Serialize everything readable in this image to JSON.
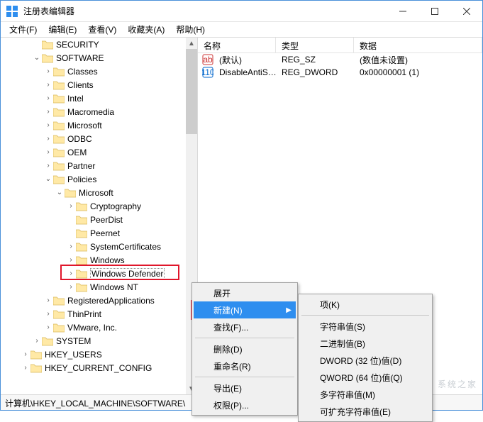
{
  "window": {
    "title": "注册表编辑器"
  },
  "menubar": [
    "文件(F)",
    "编辑(E)",
    "查看(V)",
    "收藏夹(A)",
    "帮助(H)"
  ],
  "tree": {
    "items": [
      {
        "depth": 2,
        "exp": "none",
        "label": "SECURITY"
      },
      {
        "depth": 2,
        "exp": "open",
        "label": "SOFTWARE"
      },
      {
        "depth": 3,
        "exp": "closed",
        "label": "Classes"
      },
      {
        "depth": 3,
        "exp": "closed",
        "label": "Clients"
      },
      {
        "depth": 3,
        "exp": "closed",
        "label": "Intel"
      },
      {
        "depth": 3,
        "exp": "closed",
        "label": "Macromedia"
      },
      {
        "depth": 3,
        "exp": "closed",
        "label": "Microsoft"
      },
      {
        "depth": 3,
        "exp": "closed",
        "label": "ODBC"
      },
      {
        "depth": 3,
        "exp": "closed",
        "label": "OEM"
      },
      {
        "depth": 3,
        "exp": "closed",
        "label": "Partner"
      },
      {
        "depth": 3,
        "exp": "open",
        "label": "Policies"
      },
      {
        "depth": 4,
        "exp": "open",
        "label": "Microsoft"
      },
      {
        "depth": 5,
        "exp": "closed",
        "label": "Cryptography"
      },
      {
        "depth": 5,
        "exp": "none",
        "label": "PeerDist"
      },
      {
        "depth": 5,
        "exp": "none",
        "label": "Peernet"
      },
      {
        "depth": 5,
        "exp": "closed",
        "label": "SystemCertificates"
      },
      {
        "depth": 5,
        "exp": "closed",
        "label": "Windows"
      },
      {
        "depth": 5,
        "exp": "closed",
        "label": "Windows Defender",
        "selected": true
      },
      {
        "depth": 5,
        "exp": "closed",
        "label": "Windows NT"
      },
      {
        "depth": 3,
        "exp": "closed",
        "label": "RegisteredApplications"
      },
      {
        "depth": 3,
        "exp": "closed",
        "label": "ThinPrint"
      },
      {
        "depth": 3,
        "exp": "closed",
        "label": "VMware, Inc."
      },
      {
        "depth": 2,
        "exp": "closed",
        "label": "SYSTEM"
      },
      {
        "depth": 1,
        "exp": "closed",
        "label": "HKEY_USERS"
      },
      {
        "depth": 1,
        "exp": "closed",
        "label": "HKEY_CURRENT_CONFIG"
      }
    ]
  },
  "list": {
    "columns": {
      "name": "名称",
      "type": "类型",
      "data": "数据"
    },
    "rows": [
      {
        "icon": "string",
        "name": "(默认)",
        "type": "REG_SZ",
        "data": "(数值未设置)"
      },
      {
        "icon": "binary",
        "name": "DisableAntiSp...",
        "type": "REG_DWORD",
        "data": "0x00000001 (1)"
      }
    ]
  },
  "context_main": {
    "items": [
      {
        "label": "展开",
        "enabled": true,
        "submenu": false
      },
      {
        "label": "新建(N)",
        "enabled": true,
        "submenu": true,
        "highlight": true
      },
      {
        "label": "查找(F)...",
        "enabled": true,
        "submenu": false
      },
      {
        "label": "删除(D)",
        "enabled": true,
        "submenu": false
      },
      {
        "label": "重命名(R)",
        "enabled": true,
        "submenu": false
      },
      {
        "label": "导出(E)",
        "enabled": true,
        "submenu": false
      },
      {
        "label": "权限(P)...",
        "enabled": true,
        "submenu": false
      }
    ]
  },
  "context_sub": {
    "items": [
      {
        "label": "项(K)"
      },
      {
        "label": "字符串值(S)"
      },
      {
        "label": "二进制值(B)"
      },
      {
        "label": "DWORD (32 位)值(D)"
      },
      {
        "label": "QWORD (64 位)值(Q)"
      },
      {
        "label": "多字符串值(M)"
      },
      {
        "label": "可扩充字符串值(E)"
      }
    ]
  },
  "statusbar": "计算机\\HKEY_LOCAL_MACHINE\\SOFTWARE\\",
  "watermark": "系统之家"
}
